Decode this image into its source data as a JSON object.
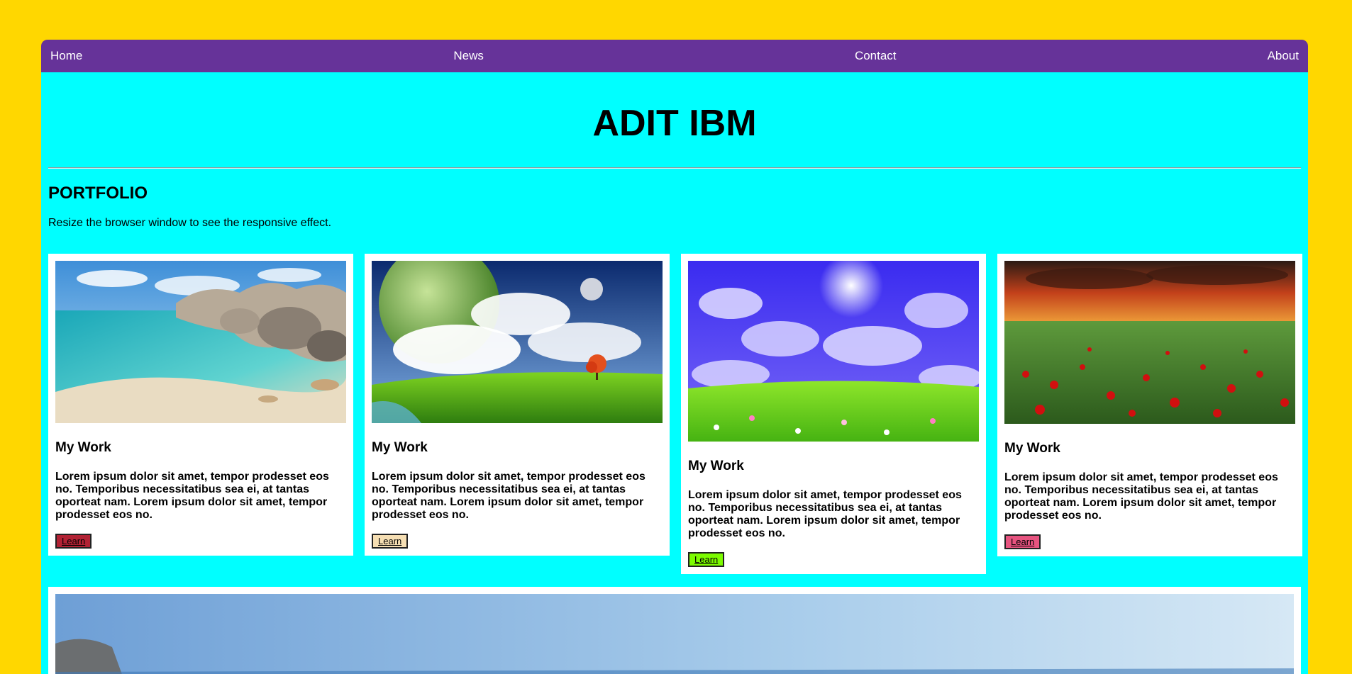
{
  "nav": {
    "items": [
      {
        "label": "Home"
      },
      {
        "label": "News"
      },
      {
        "label": "Contact"
      },
      {
        "label": "About"
      }
    ]
  },
  "header": {
    "title": "ADIT IBM"
  },
  "portfolio": {
    "heading": "PORTFOLIO",
    "intro": "Resize the browser window to see the responsive effect."
  },
  "cards": [
    {
      "heading": "My Work",
      "text": "Lorem ipsum dolor sit amet, tempor prodesset eos no. Temporibus necessitatibus sea ei, at tantas oporteat nam. Lorem ipsum dolor sit amet, tempor prodesset eos no.",
      "button": "Learn",
      "button_bg": "#B22234",
      "image": "beach-icon"
    },
    {
      "heading": "My Work",
      "text": "Lorem ipsum dolor sit amet, tempor prodesset eos no. Temporibus necessitatibus sea ei, at tantas oporteat nam. Lorem ipsum dolor sit amet, tempor prodesset eos no.",
      "button": "Learn",
      "button_bg": "#F5DEB3",
      "image": "planet-landscape-icon"
    },
    {
      "heading": "My Work",
      "text": "Lorem ipsum dolor sit amet, tempor prodesset eos no. Temporibus necessitatibus sea ei, at tantas oporteat nam. Lorem ipsum dolor sit amet, tempor prodesset eos no.",
      "button": "Learn",
      "button_bg": "#7CFC00",
      "image": "meadow-sky-icon"
    },
    {
      "heading": "My Work",
      "text": "Lorem ipsum dolor sit amet, tempor prodesset eos no. Temporibus necessitatibus sea ei, at tantas oporteat nam. Lorem ipsum dolor sit amet, tempor prodesset eos no.",
      "button": "Learn",
      "button_bg": "#E75480",
      "image": "poppy-field-icon"
    }
  ],
  "colors": {
    "page_bg": "#FFD700",
    "nav_bg": "#663399",
    "main_bg": "#00FFFF"
  }
}
